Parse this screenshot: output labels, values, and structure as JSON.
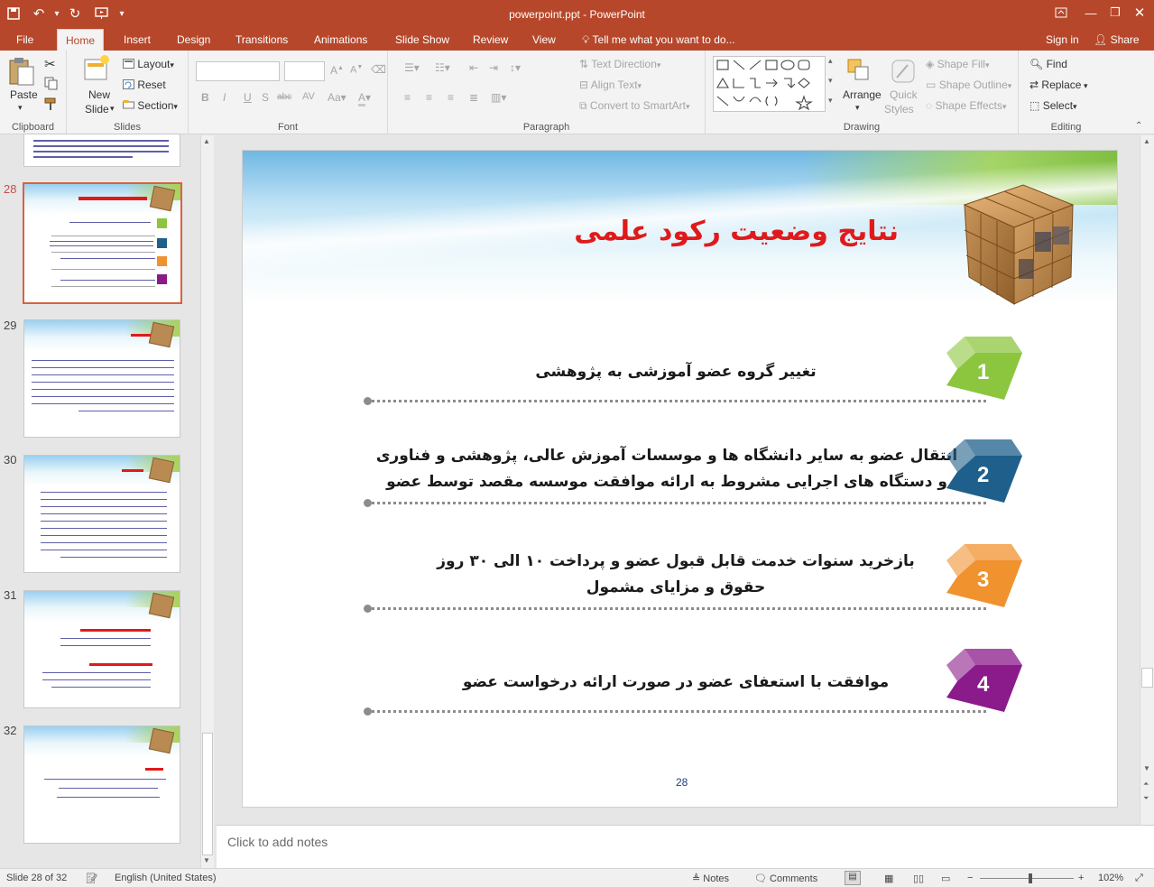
{
  "window": {
    "title": "powerpoint.ppt - PowerPoint",
    "colors": {
      "accent": "#b7472a",
      "ribbon_bg": "#f3f3f3",
      "selection": "#d86240"
    }
  },
  "tabs": [
    "File",
    "Home",
    "Insert",
    "Design",
    "Transitions",
    "Animations",
    "Slide Show",
    "Review",
    "View"
  ],
  "tell_me": "Tell me what you want to do...",
  "account": {
    "sign_in": "Sign in",
    "share": "Share"
  },
  "ribbon": {
    "clipboard": {
      "paste": "Paste",
      "label": "Clipboard"
    },
    "slides": {
      "new_slide_1": "New",
      "new_slide_2": "Slide",
      "layout": "Layout",
      "reset": "Reset",
      "section": "Section",
      "label": "Slides"
    },
    "font": {
      "label": "Font"
    },
    "paragraph": {
      "text_direction": "Text Direction",
      "align_text": "Align Text",
      "convert_smartart": "Convert to SmartArt",
      "label": "Paragraph"
    },
    "drawing": {
      "arrange": "Arrange",
      "quick_styles_1": "Quick",
      "quick_styles_2": "Styles",
      "shape_fill": "Shape Fill",
      "shape_outline": "Shape Outline",
      "shape_effects": "Shape Effects",
      "label": "Drawing"
    },
    "editing": {
      "find": "Find",
      "replace": "Replace",
      "select": "Select",
      "label": "Editing"
    }
  },
  "thumbnails": [
    {
      "num": "28",
      "current": true
    },
    {
      "num": "29",
      "current": false
    },
    {
      "num": "30",
      "current": false
    },
    {
      "num": "31",
      "current": false
    },
    {
      "num": "32",
      "current": false
    }
  ],
  "slide": {
    "title": "نتایج وضعیت رکود علمی",
    "items": [
      {
        "num": "1",
        "color": "#8cc63f",
        "lines": [
          "تغییر گروه عضو آموزشی به پژوهشی"
        ]
      },
      {
        "num": "2",
        "color": "#1f5f8b",
        "lines": [
          "انتقال عضو به سایر دانشگاه ها و موسسات آموزش عالی، پژوهشی و فناوری",
          "و دستگاه های اجرایی مشروط به ارائه موافقت موسسه مقصد توسط عضو"
        ]
      },
      {
        "num": "3",
        "color": "#f0922e",
        "lines": [
          "بازخرید سنوات خدمت قابل قبول عضو و پرداخت ۱۰ الی ۳۰ روز",
          "حقوق و مزایای مشمول"
        ]
      },
      {
        "num": "4",
        "color": "#8b1a8b",
        "lines": [
          "موافقت با استعفای عضو در صورت ارائه درخواست عضو"
        ]
      }
    ],
    "page_number": "28"
  },
  "notes_placeholder": "Click to add notes",
  "status": {
    "slide_info": "Slide 28 of 32",
    "language": "English (United States)",
    "notes": "Notes",
    "comments": "Comments",
    "zoom": "102%"
  }
}
